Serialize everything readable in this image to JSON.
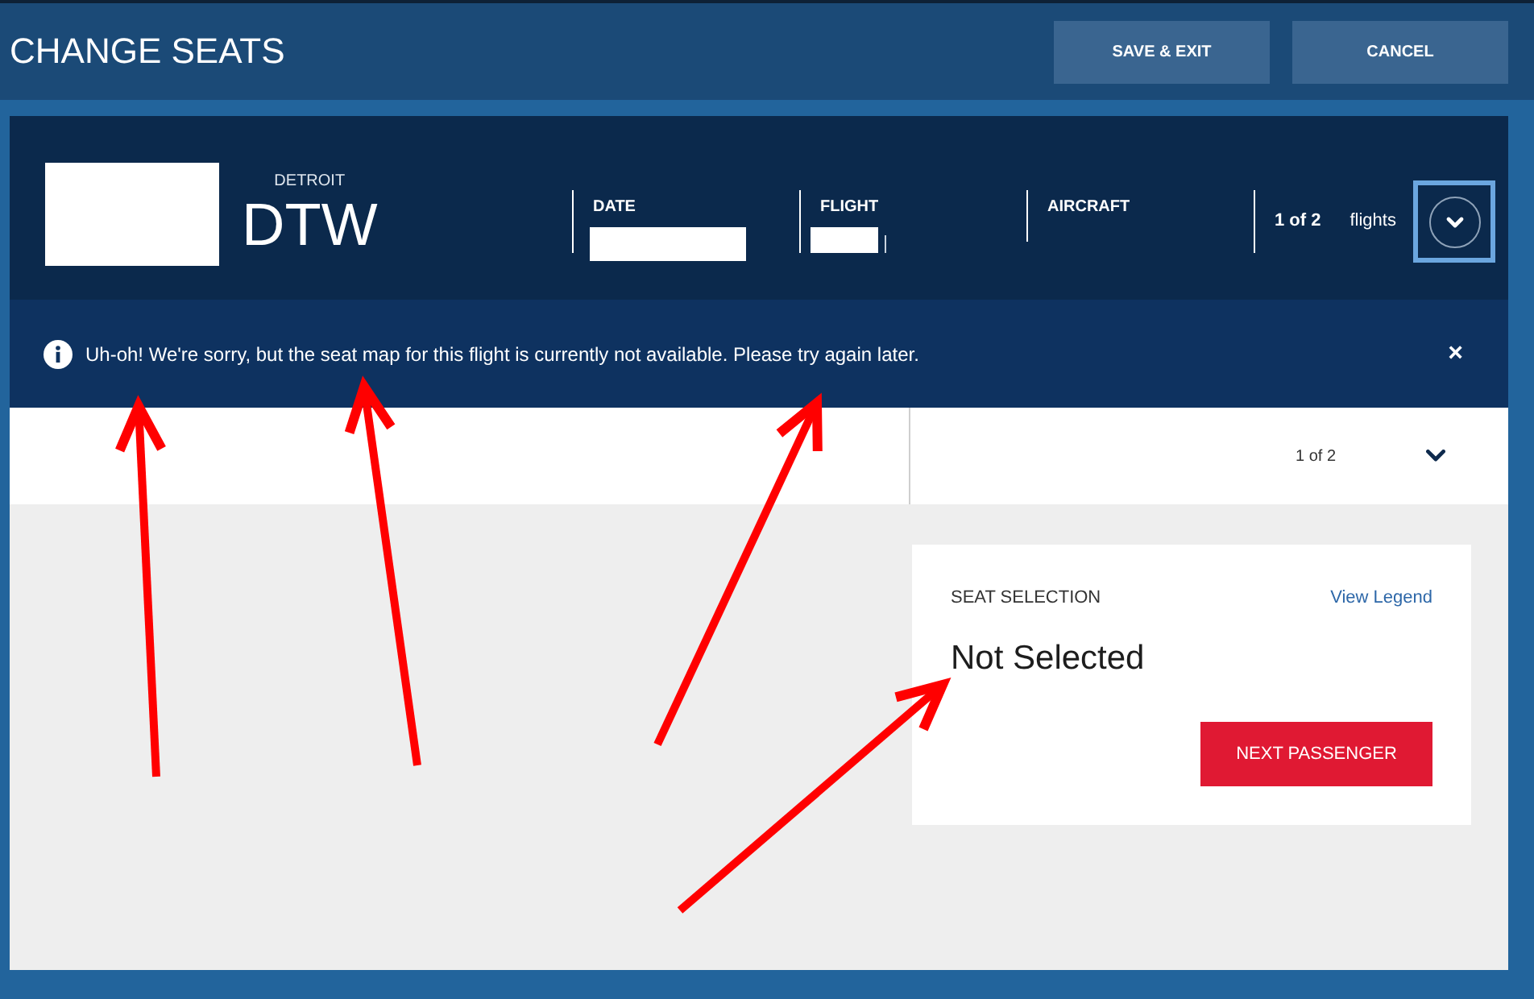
{
  "header": {
    "title": "CHANGE SEATS",
    "buttons": [
      {
        "label": "SAVE & EXIT"
      },
      {
        "label": "CANCEL"
      }
    ]
  },
  "flight_summary": {
    "city": "DETROIT",
    "airport_code": "DTW",
    "fields": [
      {
        "label": "DATE",
        "value_hidden": true
      },
      {
        "label": "FLIGHT",
        "value_hidden": true
      },
      {
        "label": "AIRCRAFT",
        "value_hidden": false
      }
    ],
    "counter": "1 of 2",
    "counter_unit": "flights",
    "dropdown": {
      "focused": true
    }
  },
  "alert": {
    "message": "Uh-oh! We're sorry, but the seat map for this flight is currently not available. Please try again later.",
    "close": "×"
  },
  "passenger_bar": {
    "counter": "1 of 2"
  },
  "seat_selection": {
    "heading": "SEAT SELECTION",
    "link": "View Legend",
    "status": "Not Selected",
    "button": "NEXT PASSENGER"
  }
}
